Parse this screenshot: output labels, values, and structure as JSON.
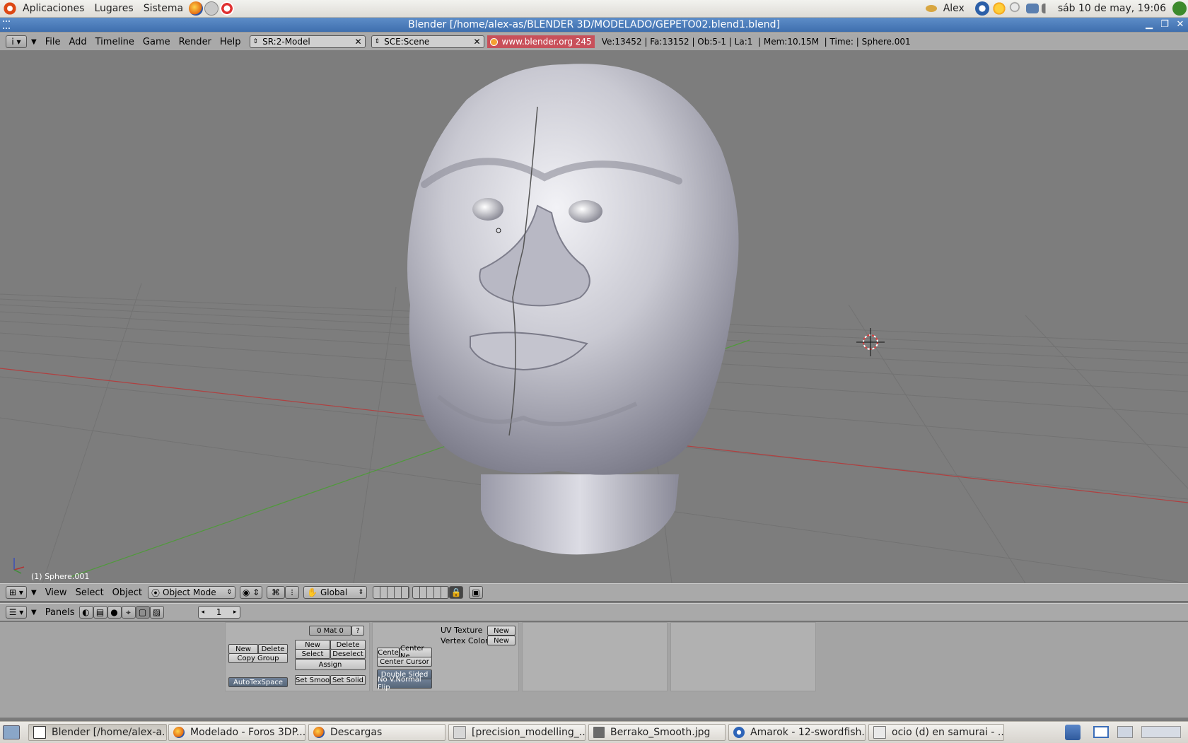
{
  "gnome_panel": {
    "menus": [
      "Aplicaciones",
      "Lugares",
      "Sistema"
    ],
    "user": "Alex",
    "clock": "sáb 10 de may, 19:06"
  },
  "window": {
    "title": "Blender [/home/alex-as/BLENDER 3D/MODELADO/GEPETO02.blend1.blend]"
  },
  "info_header": {
    "menus": [
      "File",
      "Add",
      "Timeline",
      "Game",
      "Render",
      "Help"
    ],
    "screen": "SR:2-Model",
    "scene": "SCE:Scene",
    "version_badge": "www.blender.org 245",
    "stats": "Ve:13452 | Fa:13152 | Ob:5-1 | La:1  | Mem:10.15M  | Time: | Sphere.001"
  },
  "viewport": {
    "object_label": "(1) Sphere.001"
  },
  "view3d_header": {
    "menus": [
      "View",
      "Select",
      "Object"
    ],
    "mode": "Object Mode",
    "orientation": "Global"
  },
  "buttons_header": {
    "panels_label": "Panels",
    "frame": "1"
  },
  "link_materials": {
    "new": "New",
    "delete": "Delete",
    "copy_group": "Copy Group",
    "autotexspace": "AutoTexSpace",
    "mat_slot": "0 Mat 0",
    "question": "?",
    "new2": "New",
    "delete2": "Delete",
    "select": "Select",
    "deselect": "Deselect",
    "assign": "Assign",
    "set_smooth": "Set Smoo",
    "set_solid": "Set Solid"
  },
  "mesh_panel": {
    "centre": "Cente",
    "center_new": "Center Ne",
    "center_cursor": "Center Cursor",
    "double_sided": "Double Sided",
    "no_v_normal_flip": "No V.Normal Flip",
    "uv_texture": "UV Texture",
    "vertex_color": "Vertex Color",
    "new_uv": "New",
    "new_vc": "New"
  },
  "taskbar": {
    "tasks": [
      "Blender [/home/alex-a...",
      "Modelado - Foros 3DP...",
      "Descargas",
      "[precision_modelling_...",
      "Berrako_Smooth.jpg",
      "Amarok - 12-swordfish...",
      "ocio (d) en samurai - ..."
    ]
  },
  "colors": {
    "viewport_bg": "#7d7d7d",
    "header_bg": "#a9a9a9",
    "version_badge_bg": "#c8505a",
    "titlebar": "#4a7bbd",
    "x_axis": "#b04040",
    "y_axis": "#4f9a3a"
  }
}
